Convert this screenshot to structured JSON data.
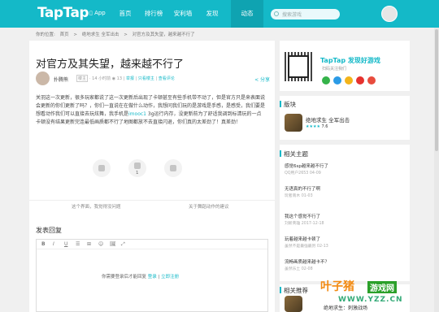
{
  "header": {
    "logo": "TapTap",
    "app": "▯ App",
    "nav": [
      "首页",
      "排行榜",
      "安利墙",
      "发现",
      "动态"
    ],
    "search_placeholder": "搜索游戏"
  },
  "breadcrumb": [
    "你的位置:",
    "首页",
    ">",
    "绝地求生 全军出击",
    ">",
    "对官方及其失望，越来越不行了"
  ],
  "post": {
    "title": "对官方及其失望，越来越不行了",
    "author": "扑腾熊",
    "badge": "楼主",
    "time": "· 14 小时前",
    "views": "◉ 13",
    "flag": "举报",
    "edit": "只看楼主",
    "collect": "查看评论",
    "share": "< 分享",
    "body_1": "关羽这一次更新，很多玩家都说了这一次更新后出现了卡顿甚至有些手机带不动了，但是官方只是来表面说会更新的你们更新了吗？，你们一直说在在做什么动作，我想问我们玩的是游戏是手感，是感受，我们要是想看动作我们可以直接去玩炫舞，我手机是",
    "body_hl": "imooc1",
    "body_2": " 3g运行内存，没更新前为了舒适我调到标清玩的一点卡顿没有结果更新完连最低画质都不行了地图都放不去直接闪退，你们真的太差劲了！真差劲！",
    "like_count": "1"
  },
  "recommend": {
    "left": "这个界面，我觉得没问题",
    "right": "关于舞蹈动作的建议"
  },
  "reply": {
    "title": "发表回复",
    "tools": [
      "B",
      "I",
      "U",
      "☰",
      "⊞",
      "☺",
      "🖼",
      "⤢"
    ],
    "login_text": "你需要登录后才能回复",
    "login": "登录",
    "sep": "|",
    "register": "立即注册"
  },
  "sidebar": {
    "brand": "TapTap 发现好游戏",
    "brand_sub": "扫码关注我们",
    "block_title": "版块",
    "game": {
      "name": "绝地求生 全军出击",
      "stars": "★★★★ ",
      "score": "7.6"
    },
    "topics_title": "相关主题",
    "topics": [
      {
        "t": "感觉6sp越来越不行了",
        "m": "QQ用户2653  04-09"
      },
      {
        "t": "无语真的不行了啊",
        "m": "玩者南木  01-03"
      },
      {
        "t": "我这个感觉不行了",
        "m": "刘新英雄  2017-12-18"
      },
      {
        "t": "玩着越来越卡顿了",
        "m": "虽然不是最强最厉  02-13"
      },
      {
        "t": "流畅画质越来越卡不？",
        "m": "虽然乐土  02-08"
      }
    ],
    "rec_title": "相关推荐",
    "rec_game": "绝地求生：刺激战场"
  },
  "watermark": {
    "w1": "叶子猪",
    "w2": "游戏网",
    "w3": "WWW.YZZ.CN"
  },
  "colors": {
    "accent": "#14b9c8"
  }
}
